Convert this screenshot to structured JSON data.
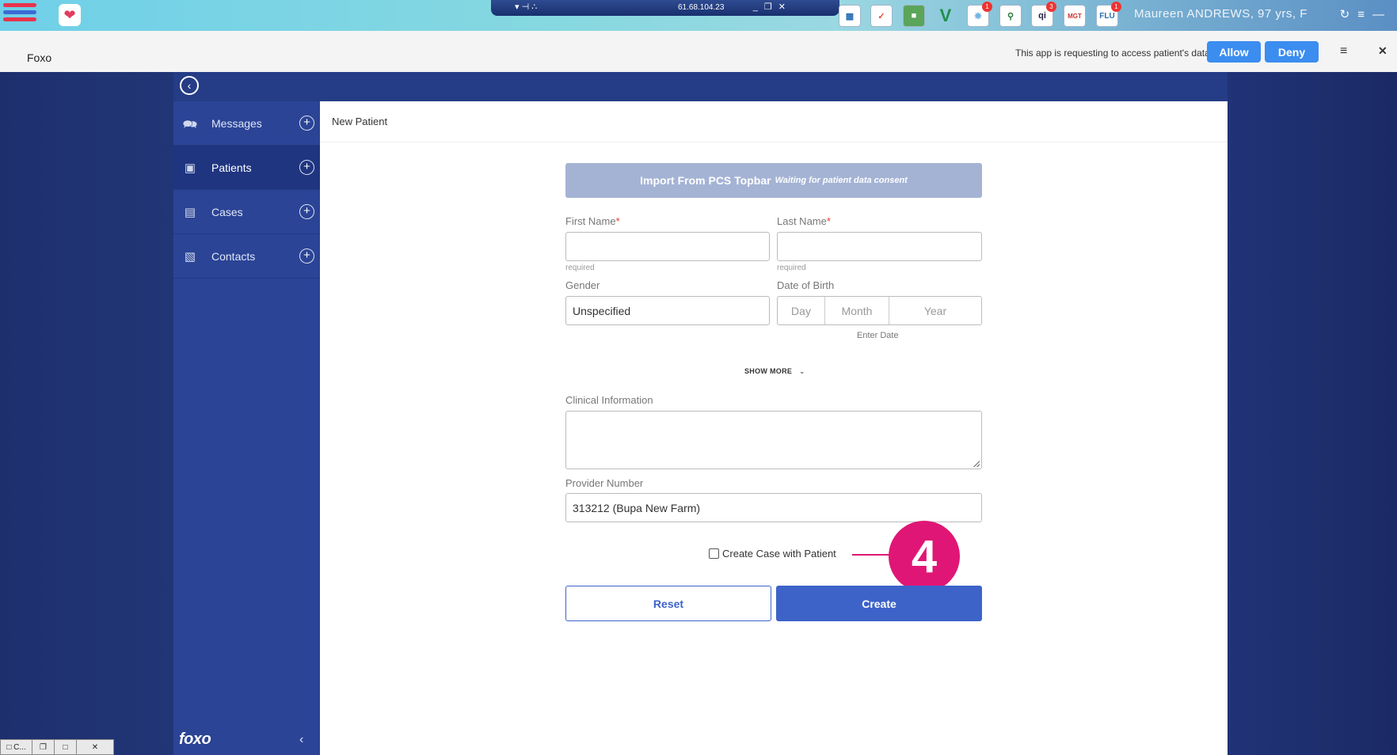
{
  "os_bar": {
    "remote_ip": "61.68.104.23",
    "patient_banner": "Maureen ANDREWS, 97 yrs, F",
    "tool_icons": [
      {
        "name": "chart-icon",
        "label": "",
        "badge": ""
      },
      {
        "name": "check-icon",
        "label": "",
        "badge": ""
      },
      {
        "name": "folder-user-icon",
        "label": "",
        "badge": ""
      },
      {
        "name": "v-icon",
        "label": "V",
        "badge": ""
      },
      {
        "name": "dandelion-icon",
        "label": "",
        "badge": "1"
      },
      {
        "name": "search-people-icon",
        "label": "",
        "badge": ""
      },
      {
        "name": "qi-icon",
        "label": "qi",
        "badge": "3"
      },
      {
        "name": "mgt-icon",
        "label": "MGT",
        "badge": ""
      },
      {
        "name": "flu-icon",
        "label": "FLU",
        "badge": "1"
      }
    ]
  },
  "consent_bar": {
    "app_title": "Foxo",
    "message": "This app is requesting to access patient's data",
    "allow_label": "Allow",
    "deny_label": "Deny"
  },
  "sidebar": {
    "items": [
      {
        "label": "Messages",
        "icon": "messages-icon",
        "active": false
      },
      {
        "label": "Patients",
        "icon": "patient-card-icon",
        "active": true
      },
      {
        "label": "Cases",
        "icon": "clipboard-icon",
        "active": false
      },
      {
        "label": "Contacts",
        "icon": "contacts-icon",
        "active": false
      }
    ],
    "logo_text": "foxo"
  },
  "content": {
    "page_title": "New Patient",
    "import_button": {
      "label": "Import From PCS Topbar",
      "status": "Waiting for patient data consent"
    },
    "first_name": {
      "label": "First Name",
      "required_mark": "*",
      "value": "",
      "hint": "required"
    },
    "last_name": {
      "label": "Last Name",
      "required_mark": "*",
      "value": "",
      "hint": "required"
    },
    "gender": {
      "label": "Gender",
      "value": "Unspecified"
    },
    "dob": {
      "label": "Date of Birth",
      "day": "Day",
      "month": "Month",
      "year": "Year",
      "hint": "Enter Date"
    },
    "show_more": "SHOW MORE",
    "clinical": {
      "label": "Clinical Information",
      "value": ""
    },
    "provider": {
      "label": "Provider Number",
      "value": "313212 (Bupa New Farm)"
    },
    "create_case": {
      "label": "Create Case with Patient",
      "checked": false
    },
    "callout_number": "4",
    "reset_label": "Reset",
    "create_label": "Create"
  },
  "colors": {
    "primary": "#3d63c9",
    "sidebar": "#2b4496",
    "callout": "#e01676",
    "allow_deny": "#3b8df0"
  }
}
